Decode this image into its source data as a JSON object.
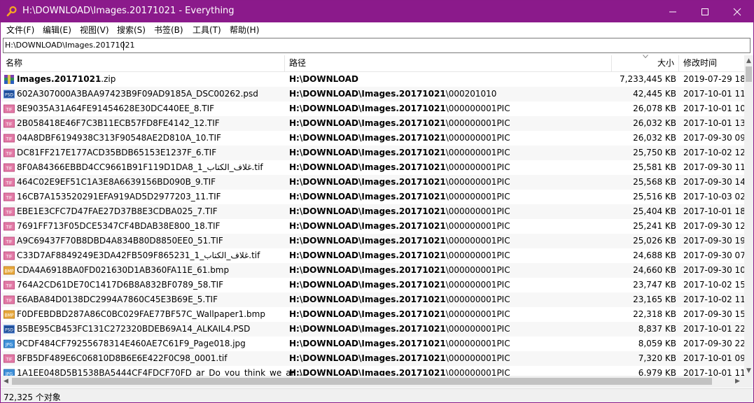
{
  "window": {
    "title": "H:\\DOWNLOAD\\Images.20171021 - Everything",
    "minimize": "—",
    "maximize": "☐",
    "close": "✕",
    "accent": "#8b1a8b"
  },
  "menu": [
    "文件(F)",
    "编辑(E)",
    "视图(V)",
    "搜索(S)",
    "书签(B)",
    "工具(T)",
    "帮助(H)"
  ],
  "search": {
    "value": "H:\\DOWNLOAD\\Images.20171021"
  },
  "columns": {
    "name": "名称",
    "path": "路径",
    "size": "大小",
    "modified": "修改时间"
  },
  "rows": [
    {
      "icon": "zip-icon",
      "name": "Images.20171021.zip",
      "name_bold": "Images.20171021",
      "name_rest": ".zip",
      "path_bold": "H:\\DOWNLOAD",
      "path_rest": "",
      "size": "7,233,445 KB",
      "date": "2019-07-29 18"
    },
    {
      "icon": "psd-icon",
      "name_bold": "",
      "name_rest": "602A307000A3BAA97423B9F09AD9185A_DSC00262.psd",
      "path_bold": "H:\\DOWNLOAD\\Images.20171021",
      "path_rest": "\\000201010",
      "size": "42,445 KB",
      "date": "2017-10-01 11"
    },
    {
      "icon": "tif-icon",
      "name_bold": "",
      "name_rest": "8E9035A31A64FE91454628E30DC440EE_8.TIF",
      "path_bold": "H:\\DOWNLOAD\\Images.20171021",
      "path_rest": "\\000000001PIC",
      "size": "26,078 KB",
      "date": "2017-10-01 10"
    },
    {
      "icon": "tif-icon",
      "name_bold": "",
      "name_rest": "2B058418E46F7C3B11ECB57FD8FE4142_12.TIF",
      "path_bold": "H:\\DOWNLOAD\\Images.20171021",
      "path_rest": "\\000000001PIC",
      "size": "26,032 KB",
      "date": "2017-10-01 13"
    },
    {
      "icon": "tif-icon",
      "name_bold": "",
      "name_rest": "04A8DBF6194938C313F90548AE2D810A_10.TIF",
      "path_bold": "H:\\DOWNLOAD\\Images.20171021",
      "path_rest": "\\000000001PIC",
      "size": "26,032 KB",
      "date": "2017-09-30 09"
    },
    {
      "icon": "tif-icon",
      "name_bold": "",
      "name_rest": "DC81FF217E177ACD35BDB65153E1237F_6.TIF",
      "path_bold": "H:\\DOWNLOAD\\Images.20171021",
      "path_rest": "\\000000001PIC",
      "size": "25,750 KB",
      "date": "2017-10-02 12"
    },
    {
      "icon": "tif-icon",
      "name_bold": "",
      "name_rest": "8F0A84366EBBD4CC9661B91F119D1DA8_1_غلاف_الكتاب.tif",
      "path_bold": "H:\\DOWNLOAD\\Images.20171021",
      "path_rest": "\\000000001PIC",
      "size": "25,581 KB",
      "date": "2017-09-30 11"
    },
    {
      "icon": "tif-icon",
      "name_bold": "",
      "name_rest": "464C02E9EF51C1A3E8A6639156BD090B_9.TIF",
      "path_bold": "H:\\DOWNLOAD\\Images.20171021",
      "path_rest": "\\000000001PIC",
      "size": "25,568 KB",
      "date": "2017-09-30 14"
    },
    {
      "icon": "tif-icon",
      "name_bold": "",
      "name_rest": "16CB7A153520291EFA919AD5D2977203_11.TIF",
      "path_bold": "H:\\DOWNLOAD\\Images.20171021",
      "path_rest": "\\000000001PIC",
      "size": "25,516 KB",
      "date": "2017-10-03 02"
    },
    {
      "icon": "tif-icon",
      "name_bold": "",
      "name_rest": "EBE1E3CFC7D47FAE27D37B8E3CDBA025_7.TIF",
      "path_bold": "H:\\DOWNLOAD\\Images.20171021",
      "path_rest": "\\000000001PIC",
      "size": "25,404 KB",
      "date": "2017-10-01 18"
    },
    {
      "icon": "tif-icon",
      "name_bold": "",
      "name_rest": "7691FF713F05DCE5347CF4BDAB38E800_18.TIF",
      "path_bold": "H:\\DOWNLOAD\\Images.20171021",
      "path_rest": "\\000000001PIC",
      "size": "25,241 KB",
      "date": "2017-09-30 12"
    },
    {
      "icon": "tif-icon",
      "name_bold": "",
      "name_rest": "A9C69437F70B8DBD4A834B80D8850EE0_51.TIF",
      "path_bold": "H:\\DOWNLOAD\\Images.20171021",
      "path_rest": "\\000000001PIC",
      "size": "25,026 KB",
      "date": "2017-09-30 19"
    },
    {
      "icon": "tif-icon",
      "name_bold": "",
      "name_rest": "C33D7AF8849249E3DA42FB509F865231_1_غلاف_الكتاب.tif",
      "path_bold": "H:\\DOWNLOAD\\Images.20171021",
      "path_rest": "\\000000001PIC",
      "size": "24,688 KB",
      "date": "2017-09-30 07"
    },
    {
      "icon": "bmp-icon",
      "name_bold": "",
      "name_rest": "CDA4A6918BA0FD021630D1AB360FA11E_61.bmp",
      "path_bold": "H:\\DOWNLOAD\\Images.20171021",
      "path_rest": "\\000000001PIC",
      "size": "24,660 KB",
      "date": "2017-09-30 10"
    },
    {
      "icon": "tif-icon",
      "name_bold": "",
      "name_rest": "764A2CD61DE70C1417D6B8A832BF0789_58.TIF",
      "path_bold": "H:\\DOWNLOAD\\Images.20171021",
      "path_rest": "\\000000001PIC",
      "size": "23,747 KB",
      "date": "2017-10-02 15"
    },
    {
      "icon": "tif-icon",
      "name_bold": "",
      "name_rest": "E6ABA84D0138DC2994A7860C45E3B69E_5.TIF",
      "path_bold": "H:\\DOWNLOAD\\Images.20171021",
      "path_rest": "\\000000001PIC",
      "size": "23,165 KB",
      "date": "2017-10-02 11"
    },
    {
      "icon": "bmp-icon",
      "name_bold": "",
      "name_rest": "F0DFEBDBD287A86C0BC029FAE77BF57C_Wallpaper1.bmp",
      "path_bold": "H:\\DOWNLOAD\\Images.20171021",
      "path_rest": "\\000000001PIC",
      "size": "22,318 KB",
      "date": "2017-09-30 15"
    },
    {
      "icon": "psd-icon",
      "name_bold": "",
      "name_rest": "B5BE95CB453FC131C272320BDEB69A14_ALKAIL4.PSD",
      "path_bold": "H:\\DOWNLOAD\\Images.20171021",
      "path_rest": "\\000000001PIC",
      "size": "8,837 KB",
      "date": "2017-10-01 22"
    },
    {
      "icon": "jpg-icon",
      "name_bold": "",
      "name_rest": "9CDF484CF79255678314E460AE7C61F9_Page018.jpg",
      "path_bold": "H:\\DOWNLOAD\\Images.20171021",
      "path_rest": "\\000000001PIC",
      "size": "8,059 KB",
      "date": "2017-09-30 22"
    },
    {
      "icon": "tif-icon",
      "name_bold": "",
      "name_rest": "8FB5DF489E6C06810D8B6E6E422F0C98_0001.tif",
      "path_bold": "H:\\DOWNLOAD\\Images.20171021",
      "path_rest": "\\000000001PIC",
      "size": "7,320 KB",
      "date": "2017-10-01 09"
    },
    {
      "icon": "jpg-icon",
      "name_bold": "",
      "name_rest": "1A1EE048D5B1538BA5444CF4FDCF70FD_ar_Do_you_think_we_ar...",
      "path_bold": "H:\\DOWNLOAD\\Images.20171021",
      "path_rest": "\\000000001PIC",
      "size": "6,979 KB",
      "date": "2017-10-01 11"
    }
  ],
  "status": {
    "count": "72,325 个对象"
  }
}
